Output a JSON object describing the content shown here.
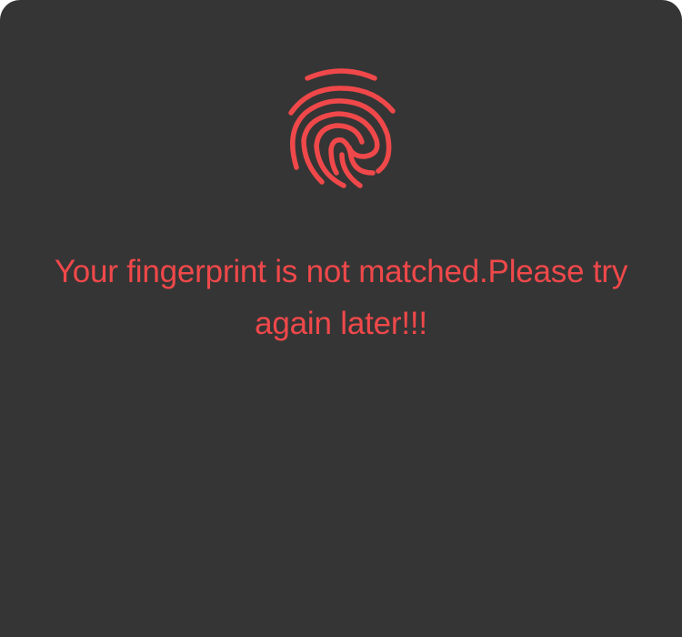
{
  "dialog": {
    "icon": "fingerprint-icon",
    "message": "Your fingerprint is not matched.Please try again later!!!"
  },
  "colors": {
    "background": "#353535",
    "accent": "#f0484a"
  }
}
